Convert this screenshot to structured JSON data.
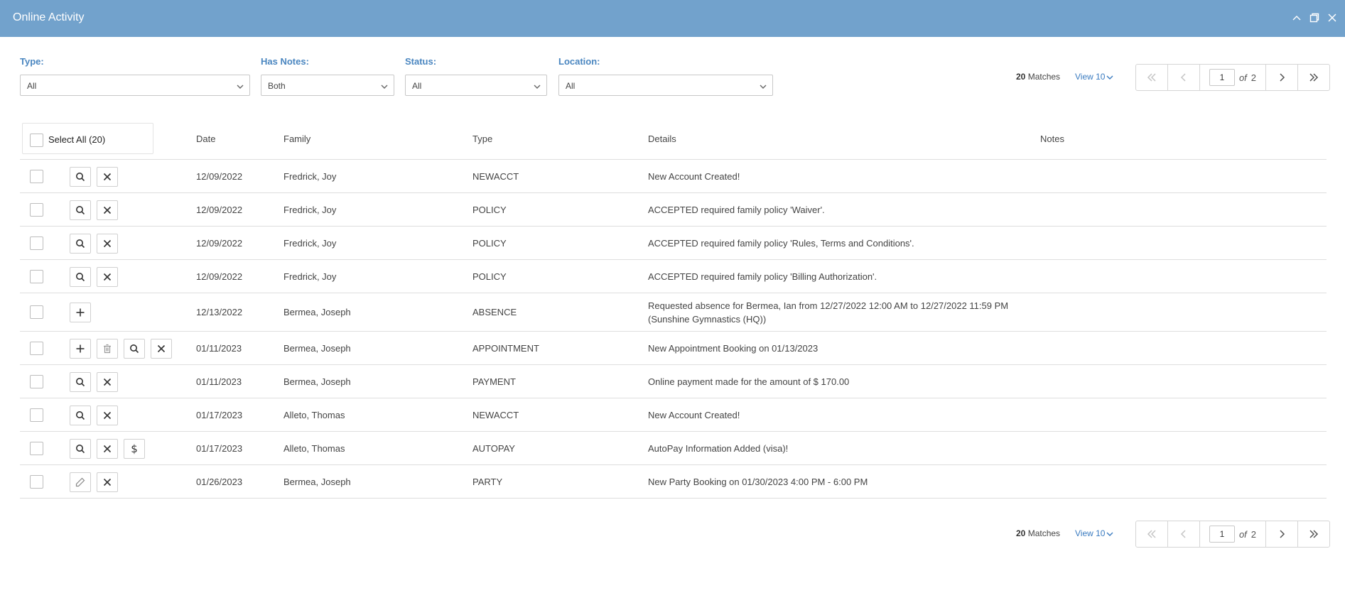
{
  "window": {
    "title": "Online Activity"
  },
  "filters": {
    "type": {
      "label": "Type:",
      "value": "All"
    },
    "has_notes": {
      "label": "Has Notes:",
      "value": "Both"
    },
    "status": {
      "label": "Status:",
      "value": "All"
    },
    "location": {
      "label": "Location:",
      "value": "All"
    }
  },
  "pagination": {
    "matches_count": "20",
    "matches_label": "Matches",
    "view_label": "View 10",
    "current_page": "1",
    "of_label": "of",
    "total_pages": "2"
  },
  "select_all_label": "Select All (20)",
  "columns": {
    "date": "Date",
    "family": "Family",
    "type": "Type",
    "details": "Details",
    "notes": "Notes"
  },
  "rows": [
    {
      "date": "12/09/2022",
      "family": "Fredrick, Joy",
      "type": "NEWACCT",
      "details": "New Account Created!",
      "details2": "",
      "notes": "",
      "actions": [
        "search-icon",
        "close-icon"
      ]
    },
    {
      "date": "12/09/2022",
      "family": "Fredrick, Joy",
      "type": "POLICY",
      "details": "ACCEPTED required family policy 'Waiver'.",
      "details2": "",
      "notes": "",
      "actions": [
        "search-icon",
        "close-icon"
      ]
    },
    {
      "date": "12/09/2022",
      "family": "Fredrick, Joy",
      "type": "POLICY",
      "details": "ACCEPTED required family policy 'Rules, Terms and Conditions'.",
      "details2": "",
      "notes": "",
      "actions": [
        "search-icon",
        "close-icon"
      ]
    },
    {
      "date": "12/09/2022",
      "family": "Fredrick, Joy",
      "type": "POLICY",
      "details": "ACCEPTED required family policy 'Billing Authorization'.",
      "details2": "",
      "notes": "",
      "actions": [
        "search-icon",
        "close-icon"
      ]
    },
    {
      "date": "12/13/2022",
      "family": "Bermea, Joseph",
      "type": "ABSENCE",
      "details": "Requested absence for Bermea, Ian from 12/27/2022 12:00 AM to 12/27/2022 11:59 PM",
      "details2": "(Sunshine Gymnastics (HQ))",
      "notes": "",
      "actions": [
        "plus-icon"
      ]
    },
    {
      "date": "01/11/2023",
      "family": "Bermea, Joseph",
      "type": "APPOINTMENT",
      "details": "New Appointment Booking on 01/13/2023",
      "details2": "",
      "notes": "",
      "actions": [
        "plus-icon",
        "trash-icon",
        "search-icon",
        "close-icon"
      ]
    },
    {
      "date": "01/11/2023",
      "family": "Bermea, Joseph",
      "type": "PAYMENT",
      "details": "Online payment made for the amount of $ 170.00",
      "details2": "",
      "notes": "",
      "actions": [
        "search-icon",
        "close-icon"
      ]
    },
    {
      "date": "01/17/2023",
      "family": "Alleto, Thomas",
      "type": "NEWACCT",
      "details": "New Account Created!",
      "details2": "",
      "notes": "",
      "actions": [
        "search-icon",
        "close-icon"
      ]
    },
    {
      "date": "01/17/2023",
      "family": "Alleto, Thomas",
      "type": "AUTOPAY",
      "details": "AutoPay Information Added (visa)!",
      "details2": "",
      "notes": "",
      "actions": [
        "search-icon",
        "close-icon",
        "dollar-icon"
      ]
    },
    {
      "date": "01/26/2023",
      "family": "Bermea, Joseph",
      "type": "PARTY",
      "details": "New Party Booking on 01/30/2023 4:00 PM - 6:00 PM",
      "details2": "",
      "notes": "",
      "actions": [
        "pencil-icon",
        "close-icon"
      ]
    }
  ],
  "colors": {
    "titlebar": "#72a2cc",
    "accent": "#3a7bc0",
    "label": "#4a86c0"
  }
}
